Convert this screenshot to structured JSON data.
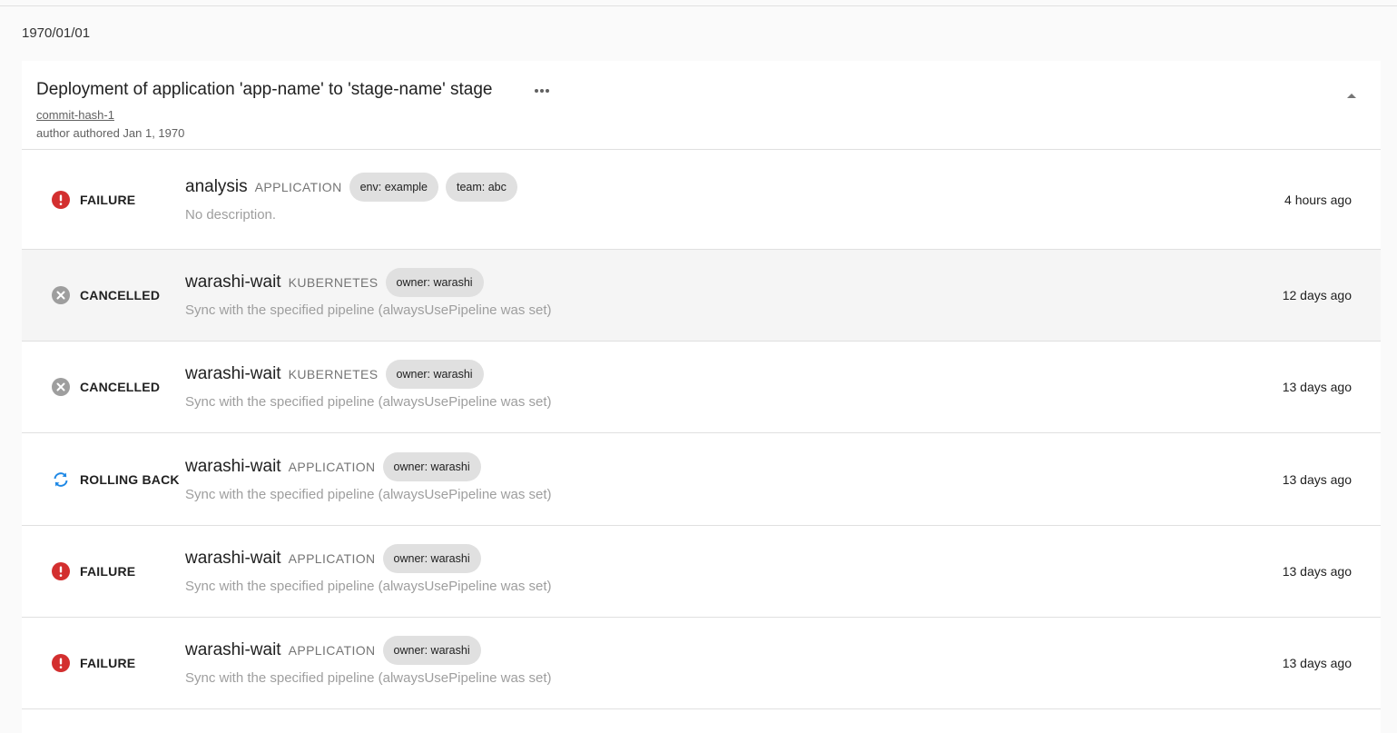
{
  "date_header": "1970/01/01",
  "deployment": {
    "title": "Deployment of application 'app-name' to 'stage-name' stage",
    "commit": "commit-hash-1",
    "author_line": "author authored Jan 1, 1970"
  },
  "rows": [
    {
      "status": "FAILURE",
      "status_icon": "error-icon",
      "name": "analysis",
      "kind": "APPLICATION",
      "labels": [
        "env: example",
        "team: abc"
      ],
      "description": "No description.",
      "time": "4 hours ago"
    },
    {
      "status": "CANCELLED",
      "status_icon": "cancel-icon",
      "name": "warashi-wait",
      "kind": "KUBERNETES",
      "labels": [
        "owner: warashi"
      ],
      "description": "Sync with the specified pipeline (alwaysUsePipeline was set)",
      "time": "12 days ago"
    },
    {
      "status": "CANCELLED",
      "status_icon": "cancel-icon",
      "name": "warashi-wait",
      "kind": "KUBERNETES",
      "labels": [
        "owner: warashi"
      ],
      "description": "Sync with the specified pipeline (alwaysUsePipeline was set)",
      "time": "13 days ago"
    },
    {
      "status": "ROLLING BACK",
      "status_icon": "sync-icon",
      "name": "warashi-wait",
      "kind": "APPLICATION",
      "labels": [
        "owner: warashi"
      ],
      "description": "Sync with the specified pipeline (alwaysUsePipeline was set)",
      "time": "13 days ago"
    },
    {
      "status": "FAILURE",
      "status_icon": "error-icon",
      "name": "warashi-wait",
      "kind": "APPLICATION",
      "labels": [
        "owner: warashi"
      ],
      "description": "Sync with the specified pipeline (alwaysUsePipeline was set)",
      "time": "13 days ago"
    },
    {
      "status": "FAILURE",
      "status_icon": "error-icon",
      "name": "warashi-wait",
      "kind": "APPLICATION",
      "labels": [
        "owner: warashi"
      ],
      "description": "Sync with the specified pipeline (alwaysUsePipeline was set)",
      "time": "13 days ago"
    }
  ],
  "colors": {
    "failure": "#d32f2f",
    "cancelled": "#9e9e9e",
    "rolling_back": "#1e88e5"
  }
}
